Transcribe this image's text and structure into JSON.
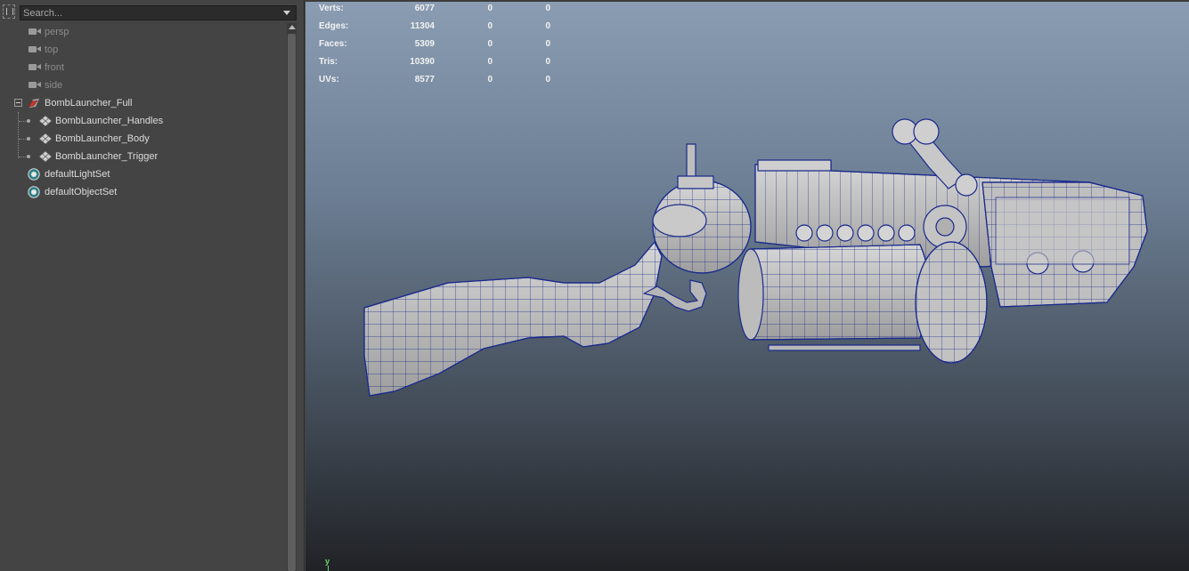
{
  "outliner": {
    "search": {
      "placeholder": "Search..."
    },
    "items": [
      {
        "label": "persp",
        "icon": "camera-icon",
        "type": "camera"
      },
      {
        "label": "top",
        "icon": "camera-icon",
        "type": "camera"
      },
      {
        "label": "front",
        "icon": "camera-icon",
        "type": "camera"
      },
      {
        "label": "side",
        "icon": "camera-icon",
        "type": "camera"
      },
      {
        "label": "BombLauncher_Full",
        "icon": "group-icon",
        "type": "group",
        "expanded": true
      },
      {
        "label": "BombLauncher_Handles",
        "icon": "mesh-icon",
        "type": "mesh"
      },
      {
        "label": "BombLauncher_Body",
        "icon": "mesh-icon",
        "type": "mesh"
      },
      {
        "label": "BombLauncher_Trigger",
        "icon": "mesh-icon",
        "type": "mesh"
      },
      {
        "label": "defaultLightSet",
        "icon": "set-icon",
        "type": "set"
      },
      {
        "label": "defaultObjectSet",
        "icon": "set-icon",
        "type": "set"
      }
    ]
  },
  "viewport": {
    "hud": [
      {
        "label": "Verts:",
        "v1": "6077",
        "v2": "0",
        "v3": "0"
      },
      {
        "label": "Edges:",
        "v1": "11304",
        "v2": "0",
        "v3": "0"
      },
      {
        "label": "Faces:",
        "v1": "5309",
        "v2": "0",
        "v3": "0"
      },
      {
        "label": "Tris:",
        "v1": "10390",
        "v2": "0",
        "v3": "0"
      },
      {
        "label": "UVs:",
        "v1": "8577",
        "v2": "0",
        "v3": "0"
      }
    ],
    "axis_label": "y",
    "colors": {
      "bg_top": "#8b9db3",
      "bg_bottom": "#202226",
      "wire": "#1a2a8c",
      "mesh": "#c4c4c4",
      "axis_y": "#6cd96c"
    }
  }
}
